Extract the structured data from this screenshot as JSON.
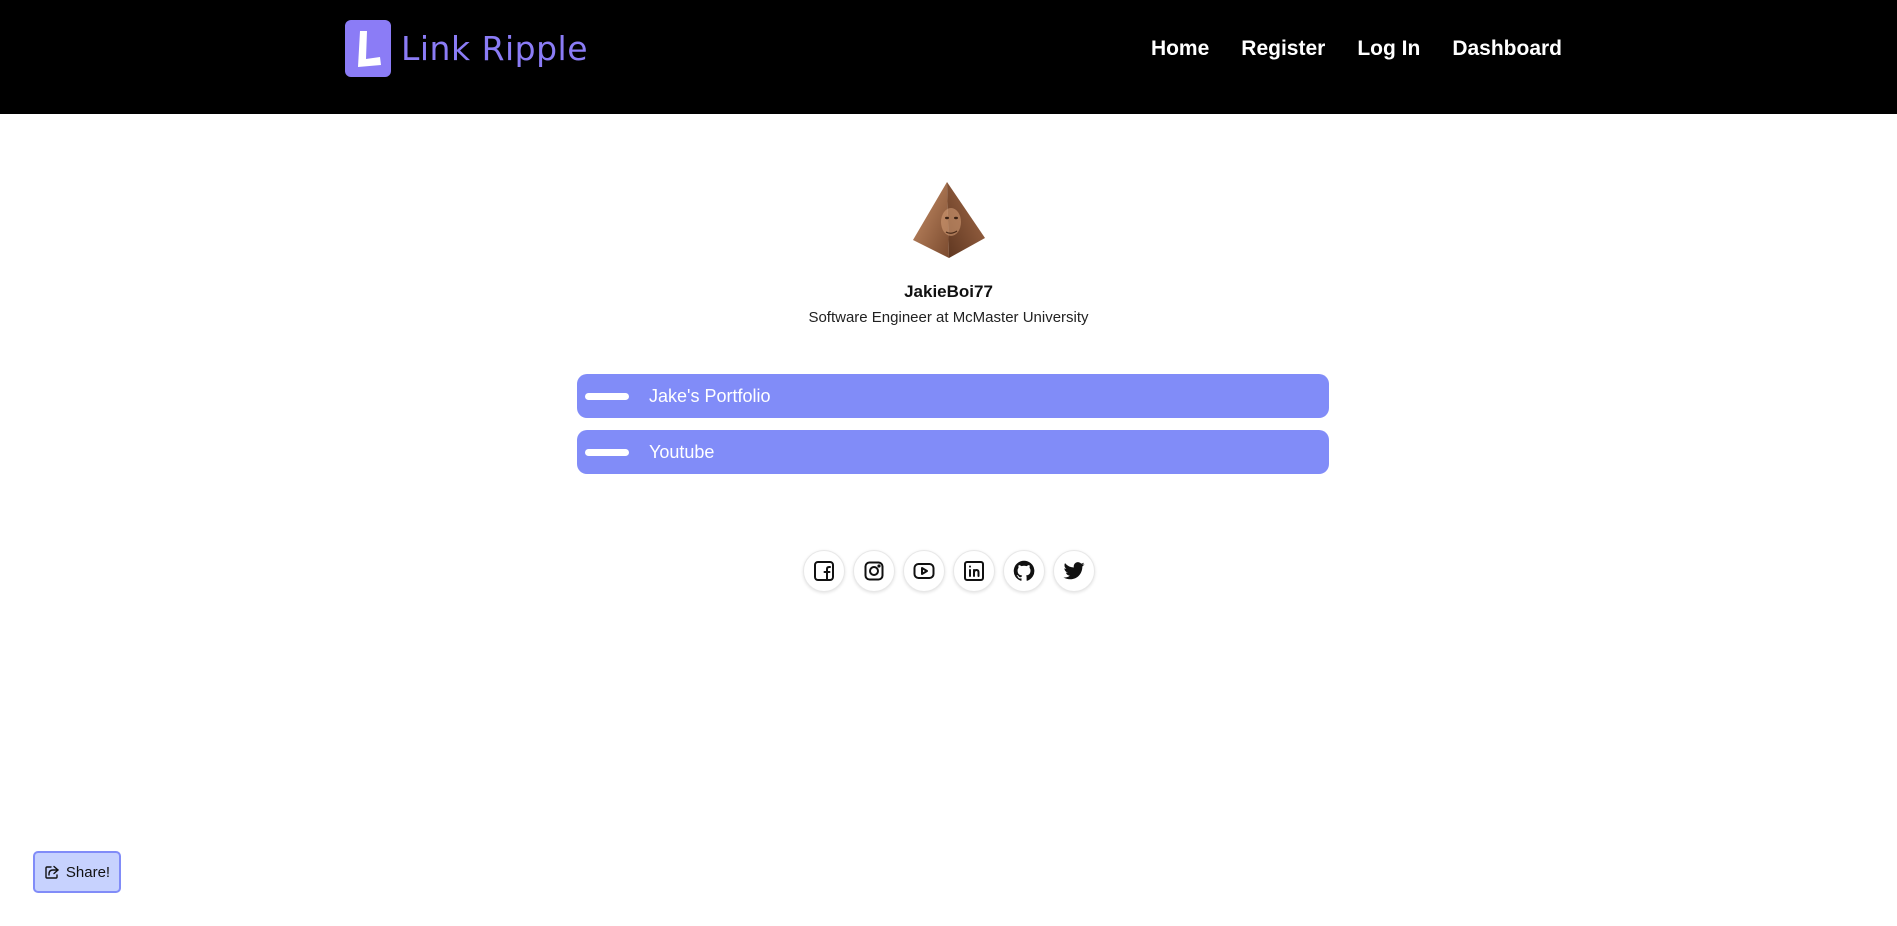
{
  "header": {
    "brand": "Link Ripple",
    "logo_icon": "letter-l-logo",
    "nav": [
      {
        "label": "Home"
      },
      {
        "label": "Register"
      },
      {
        "label": "Log In"
      },
      {
        "label": "Dashboard"
      }
    ]
  },
  "profile": {
    "avatar": "pyramid-face-avatar",
    "username": "JakieBoi77",
    "bio": "Software Engineer at McMaster University"
  },
  "links": [
    {
      "label": "Jake's Portfolio"
    },
    {
      "label": "Youtube"
    }
  ],
  "socials": [
    {
      "icon": "facebook-icon"
    },
    {
      "icon": "instagram-icon"
    },
    {
      "icon": "youtube-icon"
    },
    {
      "icon": "linkedin-icon"
    },
    {
      "icon": "github-icon"
    },
    {
      "icon": "twitter-icon"
    }
  ],
  "share": {
    "label": "Share!",
    "icon": "share-icon"
  },
  "colors": {
    "header_bg": "#000000",
    "brand": "#8b7cf6",
    "link_button": "#818cf8",
    "share_bg": "#c7d2fe",
    "share_border": "#818cf8"
  }
}
